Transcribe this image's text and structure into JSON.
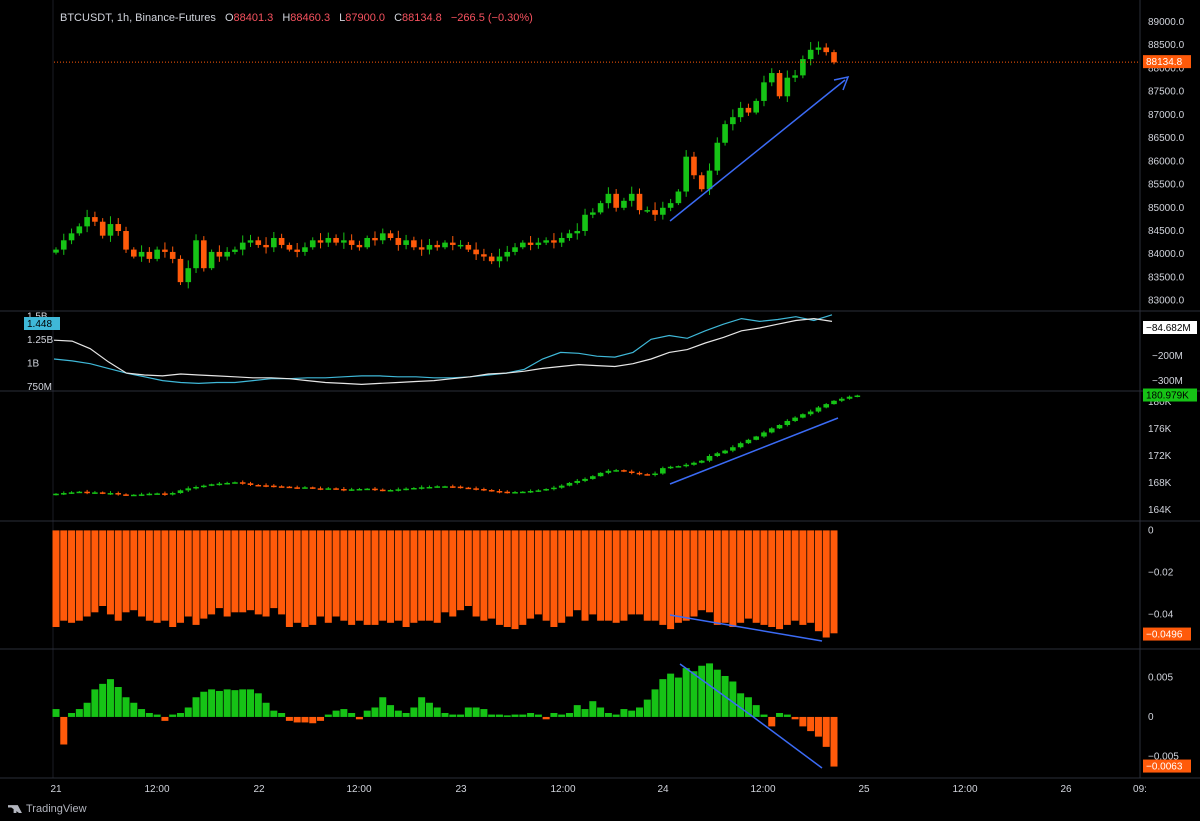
{
  "header": {
    "symbol": "BTCUSDT, 1h, Binance-Futures",
    "o_label": "O",
    "o_value": "88401.3",
    "h_label": "H",
    "h_value": "88460.3",
    "l_label": "L",
    "l_value": "87900.0",
    "c_label": "C",
    "c_value": "88134.8",
    "change": "−266.5 (−0.30%)"
  },
  "brand": "TradingView",
  "colors": {
    "up": "#16c316",
    "down": "#ff5a0a",
    "line": "#3b6bf5",
    "pane_border": "#2a2e39",
    "oi": "#3fb8d8"
  },
  "x_axis": {
    "labels": [
      "21",
      "12:00",
      "22",
      "12:00",
      "23",
      "12:00",
      "24",
      "12:00",
      "25",
      "12:00",
      "26",
      "09:"
    ]
  },
  "chart_data": [
    {
      "type": "candlestick",
      "title": "BTCUSDT, 1h, Binance-Futures",
      "yticks": [
        "89000.0",
        "88500.0",
        "88000.0",
        "87500.0",
        "87000.0",
        "86500.0",
        "86000.0",
        "85500.0",
        "85000.0",
        "84500.0",
        "84000.0",
        "83500.0",
        "83000.0"
      ],
      "ylim": [
        82800,
        89300
      ],
      "last_price_label": "88134.8",
      "close": [
        84100,
        84300,
        84450,
        84600,
        84800,
        84700,
        84400,
        84650,
        84500,
        84100,
        83950,
        84050,
        83900,
        84100,
        84050,
        83900,
        83400,
        83700,
        84300,
        83700,
        84050,
        83950,
        84050,
        84100,
        84250,
        84300,
        84200,
        84150,
        84350,
        84200,
        84100,
        84050,
        84150,
        84300,
        84250,
        84350,
        84250,
        84300,
        84200,
        84150,
        84350,
        84300,
        84450,
        84350,
        84200,
        84300,
        84150,
        84100,
        84200,
        84150,
        84250,
        84200,
        84200,
        84100,
        84000,
        83950,
        83850,
        83950,
        84050,
        84150,
        84250,
        84200,
        84250,
        84300,
        84250,
        84350,
        84450,
        84500,
        84850,
        84900,
        85100,
        85300,
        85000,
        85150,
        85300,
        84950,
        84950,
        84850,
        85000,
        85100,
        85350,
        86100,
        85700,
        85400,
        85800,
        86400,
        86800,
        86950,
        87150,
        87050,
        87300,
        87700,
        87900,
        87400,
        87800,
        87850,
        88200,
        88400,
        88450,
        88350,
        88130
      ],
      "open_hint": "previous close",
      "annotation": "upward trend arrow"
    },
    {
      "type": "line",
      "name": "",
      "yticks": [
        "1.5B",
        "1.25B",
        "1B",
        "750M"
      ],
      "right_ticks": [
        "−200M",
        "−300M"
      ],
      "left_badge": "1.448",
      "right_badge": "−84.682M",
      "series": [
        {
          "name": "",
          "color": "#3fb8d8",
          "values": [
            1.05,
            1.03,
            1.0,
            0.95,
            0.9,
            0.86,
            0.82,
            0.8,
            0.79,
            0.8,
            0.8,
            0.82,
            0.84,
            0.84,
            0.85,
            0.85,
            0.86,
            0.87,
            0.87,
            0.86,
            0.86,
            0.85,
            0.85,
            0.86,
            0.88,
            0.9,
            0.94,
            1.05,
            1.12,
            1.11,
            1.08,
            1.07,
            1.12,
            1.26,
            1.3,
            1.27,
            1.35,
            1.42,
            1.48,
            1.45,
            1.47,
            1.5,
            1.46,
            1.52
          ]
        },
        {
          "name": "",
          "color": "#e6e6e6",
          "values": [
            1.25,
            1.24,
            1.16,
            1.02,
            0.9,
            0.88,
            0.87,
            0.89,
            0.88,
            0.87,
            0.86,
            0.85,
            0.85,
            0.84,
            0.82,
            0.8,
            0.79,
            0.78,
            0.79,
            0.8,
            0.81,
            0.82,
            0.84,
            0.86,
            0.89,
            0.9,
            0.92,
            0.95,
            0.97,
            0.99,
            0.98,
            0.97,
            1.0,
            1.05,
            1.12,
            1.15,
            1.22,
            1.28,
            1.35,
            1.38,
            1.42,
            1.46,
            1.48,
            1.45
          ]
        }
      ]
    },
    {
      "type": "candlestick",
      "name": "",
      "yticks": [
        "180K",
        "176K",
        "172K",
        "168K",
        "164K"
      ],
      "ylim": [
        162500,
        181500
      ],
      "last_value_label": "180.979K",
      "close": [
        166400,
        166500,
        166600,
        166700,
        166550,
        166600,
        166450,
        166500,
        166300,
        166250,
        166250,
        166300,
        166400,
        166450,
        166300,
        166500,
        166900,
        167200,
        167400,
        167600,
        167800,
        167900,
        168000,
        168100,
        167950,
        167700,
        167650,
        167600,
        167500,
        167450,
        167350,
        167300,
        167350,
        167200,
        167150,
        167200,
        167100,
        167000,
        167050,
        167100,
        167150,
        167000,
        166900,
        166950,
        167050,
        167150,
        167250,
        167350,
        167400,
        167500,
        167500,
        167450,
        167300,
        167200,
        167100,
        166950,
        166800,
        166700,
        166600,
        166650,
        166700,
        166800,
        166900,
        167100,
        167300,
        167600,
        168000,
        168300,
        168600,
        169000,
        169500,
        169800,
        169900,
        169700,
        169500,
        169300,
        169200,
        169400,
        170200,
        170400,
        170500,
        170700,
        171000,
        171300,
        172000,
        172400,
        172800,
        173300,
        173900,
        174400,
        174900,
        175500,
        176100,
        176600,
        177200,
        177700,
        178200,
        178600,
        179200,
        179700,
        180200,
        180500,
        180800,
        180979
      ],
      "annotation": "upward trend line"
    },
    {
      "type": "bar",
      "name": "",
      "yticks": [
        "0",
        "−0.02",
        "−0.04"
      ],
      "ylim": [
        -0.056,
        0.004
      ],
      "last_value_label": "−0.0496",
      "values": [
        -0.046,
        -0.043,
        -0.044,
        -0.043,
        -0.041,
        -0.039,
        -0.036,
        -0.04,
        -0.043,
        -0.039,
        -0.038,
        -0.041,
        -0.043,
        -0.044,
        -0.043,
        -0.046,
        -0.044,
        -0.041,
        -0.045,
        -0.042,
        -0.04,
        -0.037,
        -0.041,
        -0.039,
        -0.039,
        -0.038,
        -0.04,
        -0.041,
        -0.037,
        -0.04,
        -0.046,
        -0.044,
        -0.046,
        -0.045,
        -0.041,
        -0.044,
        -0.041,
        -0.043,
        -0.045,
        -0.043,
        -0.045,
        -0.045,
        -0.043,
        -0.044,
        -0.043,
        -0.046,
        -0.044,
        -0.043,
        -0.043,
        -0.044,
        -0.039,
        -0.041,
        -0.038,
        -0.036,
        -0.041,
        -0.043,
        -0.042,
        -0.045,
        -0.046,
        -0.047,
        -0.045,
        -0.042,
        -0.04,
        -0.043,
        -0.046,
        -0.044,
        -0.041,
        -0.038,
        -0.043,
        -0.04,
        -0.043,
        -0.043,
        -0.044,
        -0.043,
        -0.04,
        -0.04,
        -0.043,
        -0.043,
        -0.045,
        -0.047,
        -0.044,
        -0.043,
        -0.041,
        -0.038,
        -0.039,
        -0.045,
        -0.044,
        -0.046,
        -0.044,
        -0.042,
        -0.044,
        -0.045,
        -0.046,
        -0.047,
        -0.045,
        -0.043,
        -0.045,
        -0.044,
        -0.048,
        -0.051,
        -0.049
      ],
      "color": "#ff5a0a",
      "annotation": "downward trend line"
    },
    {
      "type": "bar",
      "name": "",
      "yticks": [
        "0.005",
        "0",
        "−0.005"
      ],
      "ylim": [
        -0.0075,
        0.0085
      ],
      "last_value_label": "−0.0063",
      "values": [
        0.001,
        -0.0035,
        0.0005,
        0.001,
        0.0018,
        0.0035,
        0.0042,
        0.0048,
        0.0038,
        0.0025,
        0.0018,
        0.001,
        0.0005,
        0.0003,
        -0.0005,
        0.0003,
        0.0005,
        0.0012,
        0.0025,
        0.0032,
        0.0035,
        0.0033,
        0.0035,
        0.0034,
        0.0035,
        0.0035,
        0.003,
        0.0018,
        0.0008,
        0.0005,
        -0.0005,
        -0.0007,
        -0.0007,
        -0.0008,
        -0.0005,
        0.0003,
        0.0008,
        0.001,
        0.0005,
        -0.0003,
        0.0008,
        0.0012,
        0.0025,
        0.0015,
        0.0008,
        0.0005,
        0.0012,
        0.0025,
        0.0018,
        0.0012,
        0.0005,
        0.0003,
        0.0003,
        0.0012,
        0.0012,
        0.001,
        0.0003,
        0.0003,
        0.0002,
        0.0003,
        0.0003,
        0.0005,
        0.0003,
        -0.0003,
        0.0005,
        0.0003,
        0.0005,
        0.0015,
        0.001,
        0.002,
        0.0012,
        0.0005,
        0.0003,
        0.001,
        0.0008,
        0.0012,
        0.0022,
        0.0035,
        0.0048,
        0.0055,
        0.005,
        0.0062,
        0.0058,
        0.0065,
        0.0068,
        0.006,
        0.0052,
        0.0045,
        0.003,
        0.0025,
        0.0015,
        0.0003,
        -0.0012,
        0.0005,
        0.0003,
        -0.0003,
        -0.0012,
        -0.0018,
        -0.0025,
        -0.0038,
        -0.0063
      ],
      "annotation": "downward trend line"
    }
  ]
}
